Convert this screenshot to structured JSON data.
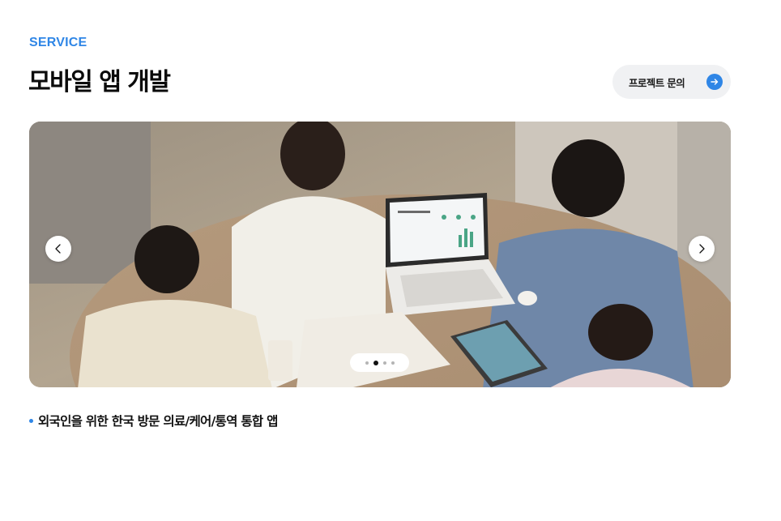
{
  "section": {
    "eyebrow": "SERVICE",
    "title": "모바일 앱 개발"
  },
  "cta": {
    "label": "프로젝트 문의",
    "icon": "arrow-right-icon",
    "icon_color": "#2f86e6"
  },
  "slider": {
    "prev_icon": "chevron-left-icon",
    "next_icon": "chevron-right-icon",
    "slide_count": 4,
    "active_slide": 2
  },
  "caption": {
    "text": "외국인을 위한 한국 방문 의료/케어/통역 통합 앱"
  },
  "colors": {
    "accent": "#2f86e6",
    "text": "#111111",
    "cta_background": "#f0f1f3"
  }
}
